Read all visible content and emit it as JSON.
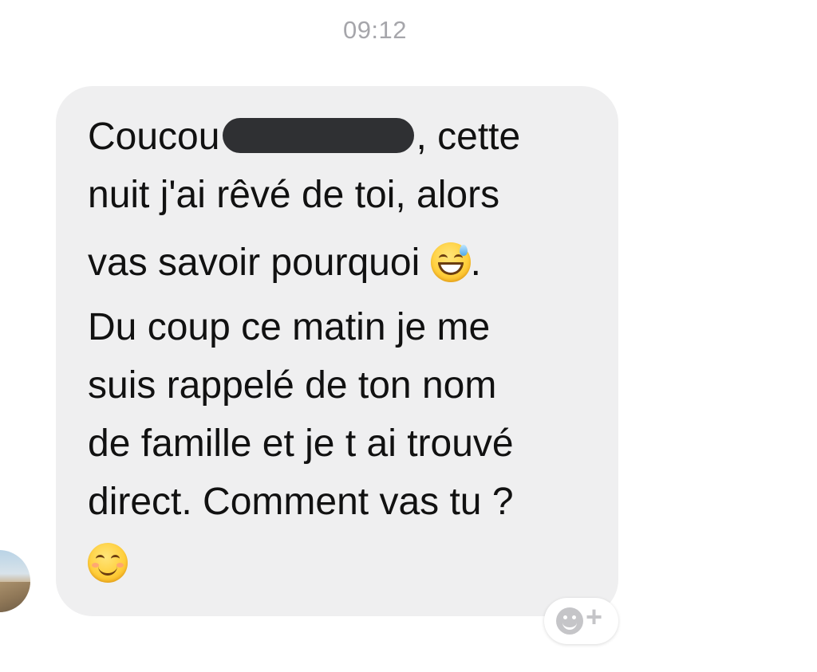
{
  "chat": {
    "timestamp": "09:12"
  },
  "message": {
    "line1_start": "Coucou",
    "line1_end": "cette",
    "line2": "nuit j'ai rêvé de toi, alors",
    "line3": "vas savoir pourquoi",
    "line3_end": ".",
    "line4": "Du coup ce matin je me",
    "line5": "suis rappelé de ton nom",
    "line6": "de famille et je t ai trouvé",
    "line7": "direct. Comment vas tu ?",
    "emoji_1": "grinning-face-with-sweat-icon",
    "emoji_2": "smiling-face-with-smiling-eyes-icon"
  },
  "reaction_button": {
    "icon": "add-reaction-icon",
    "plus": "+"
  },
  "colors": {
    "bubble_bg": "#efeff0",
    "timestamp_text": "#a6a6ab",
    "message_text": "#111111",
    "redaction": "#2f3033"
  }
}
